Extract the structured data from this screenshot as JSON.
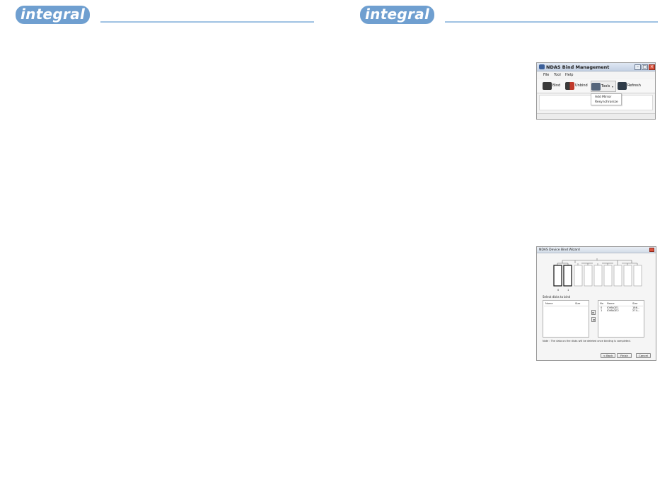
{
  "brand": {
    "logo_left": "integral",
    "logo_right": "integral",
    "colors": {
      "pill": "#6f9fd0",
      "rule": "#9fc2e3"
    }
  },
  "bind_window": {
    "title": "NDAS Bind Management",
    "menu": [
      "File",
      "Tool",
      "Help"
    ],
    "toolbar": [
      {
        "label": "Bind",
        "icon": "bind-icon"
      },
      {
        "label": "Unbind",
        "icon": "unbind-icon"
      },
      {
        "label": "Tools",
        "icon": "tools-icon"
      },
      {
        "label": "Refresh",
        "icon": "refresh-icon"
      }
    ],
    "dropdown": [
      "Add Mirror",
      "Resynchronize"
    ]
  },
  "wizard": {
    "title": "NDAS Device Bind Wizard",
    "disk_labels": [
      "0",
      "1"
    ],
    "select_label": "Select disks to bind",
    "left_columns": [
      "Name",
      "Size"
    ],
    "right_columns": [
      "No",
      "Name",
      "Size"
    ],
    "rows": [
      {
        "no": "0",
        "name": "IOMAGE1",
        "size": "186..."
      },
      {
        "no": "1",
        "name": "IOMAGE2",
        "size": "274..."
      }
    ],
    "move_right": "►",
    "move_left": "◄",
    "note": "Note : The data on the disks will be deleted once binding is completed.",
    "buttons": [
      "< Back",
      "Finish",
      "Cancel"
    ]
  }
}
